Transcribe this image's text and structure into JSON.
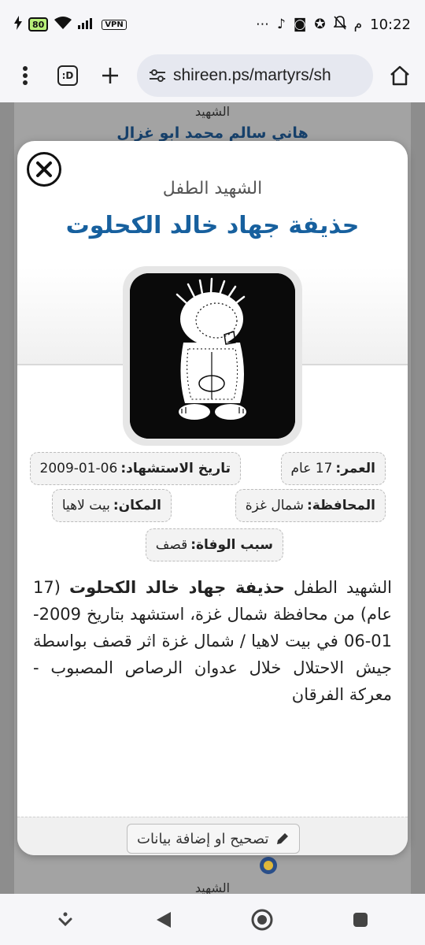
{
  "status_bar": {
    "battery": "80",
    "vpn": "VPN",
    "right_text": "م",
    "time": "10:22"
  },
  "browser": {
    "tab_label": ":D",
    "url": "shireen.ps/martyrs/sh"
  },
  "background_page": {
    "label_top": "الشهيد",
    "name_top": "هاني سالم محمد ابو غزال",
    "label_bottom": "الشهيد"
  },
  "modal": {
    "subtitle": "الشهيد الطفل",
    "title": "حذيفة جهاد خالد الكحلوت",
    "fields": {
      "age_label": "العمر:",
      "age_value": "17 عام",
      "date_label": "تاريخ الاستشهاد:",
      "date_value": "2009-01-06",
      "governorate_label": "المحافظة:",
      "governorate_value": "شمال غزة",
      "place_label": "المكان:",
      "place_value": "بيت لاهيا",
      "cause_label": "سبب الوفاة:",
      "cause_value": "قصف"
    },
    "description": {
      "prefix": "الشهيد الطفل ",
      "name": "حذيفة جهاد خالد الكحلوت",
      "text": " (17 عام) من محافظة شمال غزة، استشهد بتاريخ 2009-01-06 في بيت لاهيا / شمال غزة اثر قصف بواسطة جيش الاحتلال خلال عدوان الرصاص المصبوب - معركة الفرقان"
    },
    "edit_button": "تصحيح او إضافة بيانات"
  },
  "colors": {
    "title_blue": "#17609e",
    "dim_overlay": "#8d8d8d"
  },
  "icons": [
    "close-icon",
    "pencil-icon",
    "home-icon",
    "plus-icon",
    "menu-dots-icon",
    "site-settings-icon"
  ]
}
